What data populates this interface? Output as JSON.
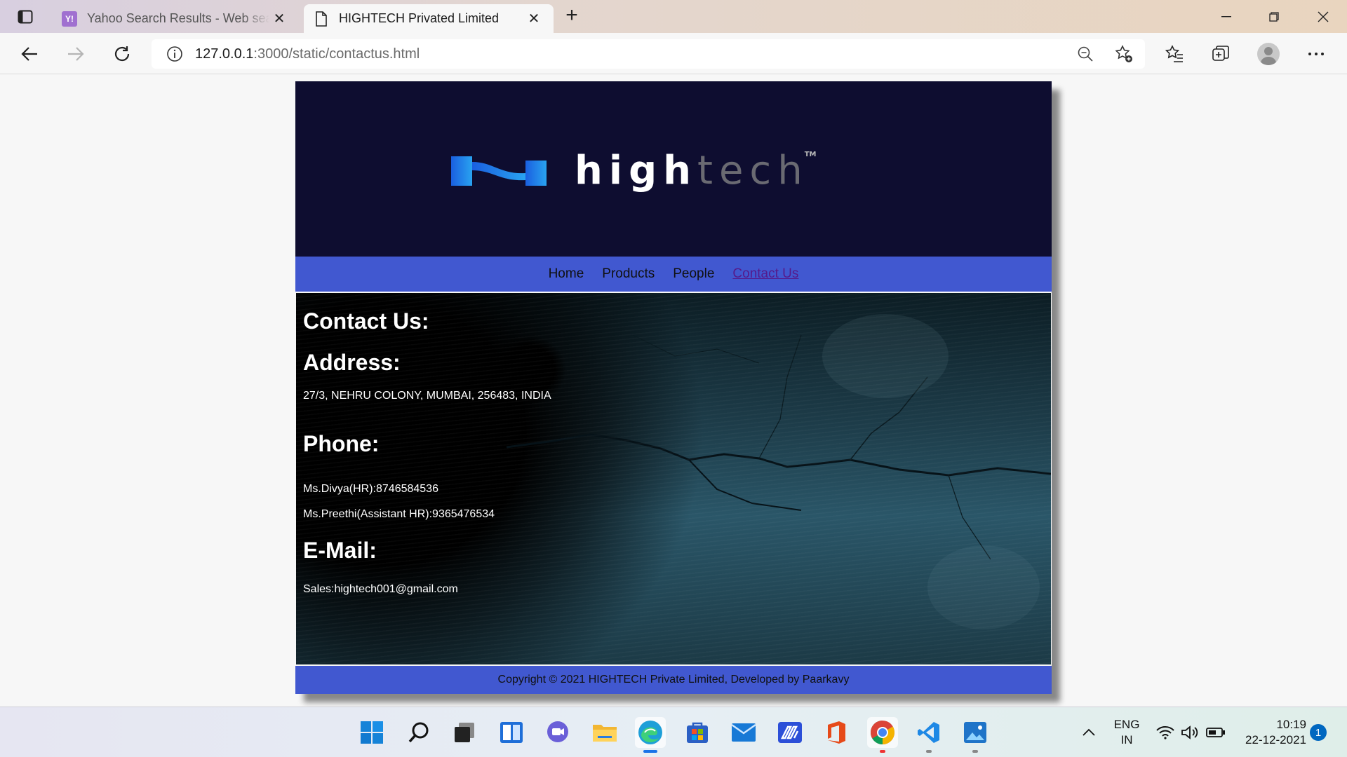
{
  "browser": {
    "tabs": [
      {
        "title": "Yahoo Search Results - Web search",
        "favicon": "yahoo-icon",
        "active": false
      },
      {
        "title": "HIGHTECH Privated Limited",
        "favicon": "page-icon",
        "active": true
      }
    ],
    "url_host": "127.0.0.1",
    "url_rest": ":3000/static/contactus.html"
  },
  "site": {
    "logo_word_bright": "high",
    "logo_word_dim": "tech",
    "logo_tm": "TM",
    "nav": [
      "Home",
      "Products",
      "People",
      "Contact Us"
    ],
    "active_nav": "Contact Us",
    "contact_heading": "Contact Us:",
    "address_heading": "Address:",
    "address_text": "27/3, NEHRU COLONY, MUMBAI, 256483, INDIA",
    "phone_heading": "Phone:",
    "phone_lines": [
      "Ms.Divya(HR):8746584536",
      "Ms.Preethi(Assistant HR):9365476534"
    ],
    "email_heading": "E-Mail:",
    "email_text": "Sales:hightech001@gmail.com",
    "footer": "Copyright © 2021 HIGHTECH Private Limited, Developed by Paarkavy"
  },
  "colors": {
    "banner": "#0e0d30",
    "nav_bar": "#4158d0",
    "logo_blue": "#1a73e8"
  },
  "taskbar": {
    "apps": [
      "start-icon",
      "search-icon",
      "task-view-icon",
      "widgets-icon",
      "chat-icon",
      "file-explorer-icon",
      "edge-icon",
      "store-icon",
      "mail-icon",
      "power-automate-icon",
      "office-icon",
      "chrome-icon",
      "vscode-icon",
      "photos-icon"
    ],
    "lang_top": "ENG",
    "lang_bottom": "IN",
    "time": "10:19",
    "date": "22-12-2021",
    "notification_count": "1"
  }
}
